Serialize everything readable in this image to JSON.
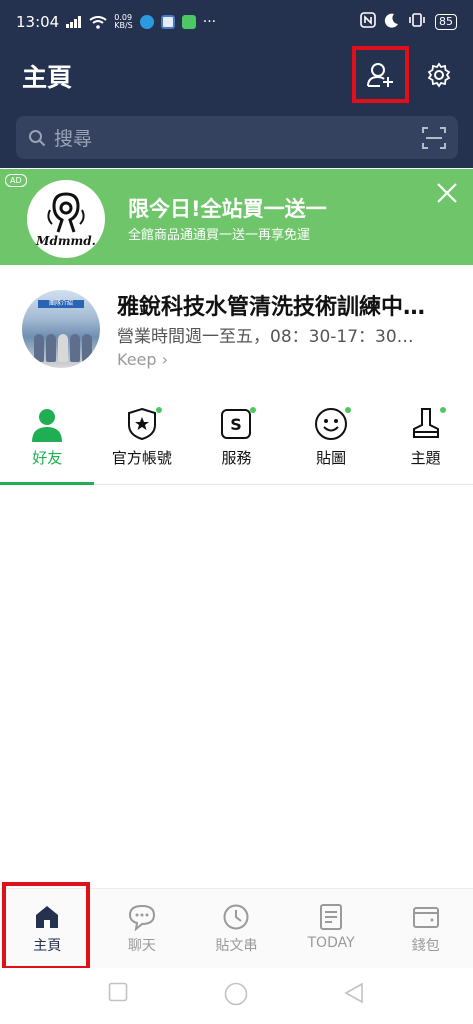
{
  "status_bar": {
    "time": "13:04",
    "net_speed_value": "0.09",
    "net_speed_unit": "KB/S",
    "battery": "85"
  },
  "header": {
    "title": "主頁",
    "search_placeholder": "搜尋"
  },
  "ad": {
    "badge": "AD",
    "logo_text": "Mdmmd.",
    "title": "限今日!全站買一送一",
    "subtitle": "全館商品通通買一送一再享免運"
  },
  "profile": {
    "avatar_banner": "團隊介紹",
    "name": "雅銳科技水管清洗技術訓練中…",
    "status": "營業時間週一至五，08：30-17：30…",
    "keep": "Keep ›"
  },
  "tabs": [
    {
      "label": "好友",
      "icon": "friends-icon",
      "active": true,
      "dot": false
    },
    {
      "label": "官方帳號",
      "icon": "official-account-icon",
      "active": false,
      "dot": true
    },
    {
      "label": "服務",
      "icon": "service-icon",
      "active": false,
      "dot": true
    },
    {
      "label": "貼圖",
      "icon": "sticker-icon",
      "active": false,
      "dot": true
    },
    {
      "label": "主題",
      "icon": "theme-icon",
      "active": false,
      "dot": true
    }
  ],
  "bottom_nav": [
    {
      "label": "主頁",
      "icon": "home-icon",
      "active": true
    },
    {
      "label": "聊天",
      "icon": "chat-icon",
      "active": false
    },
    {
      "label": "貼文串",
      "icon": "clock-icon",
      "active": false
    },
    {
      "label": "TODAY",
      "icon": "news-icon",
      "active": false
    },
    {
      "label": "錢包",
      "icon": "wallet-icon",
      "active": false
    }
  ],
  "colors": {
    "header_bg": "#243250",
    "accent_green": "#1faf52",
    "ad_bg": "#6fc66a",
    "highlight_red": "#e0101b"
  }
}
